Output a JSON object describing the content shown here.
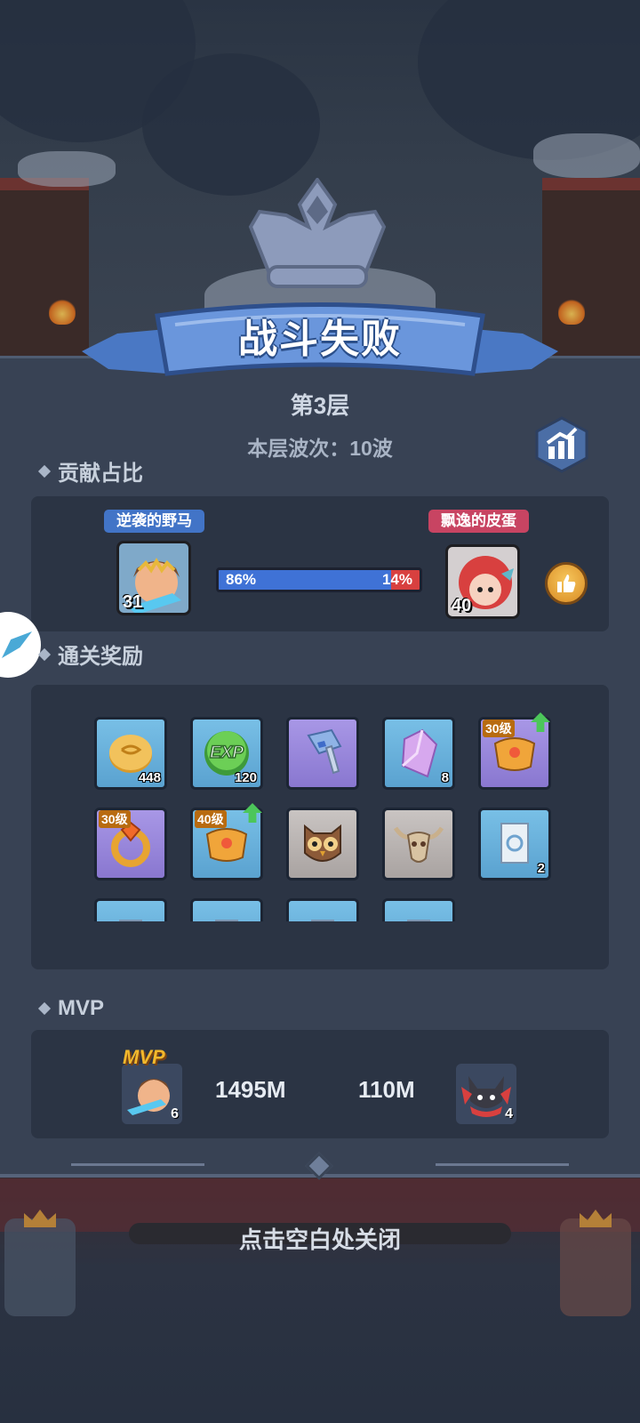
{
  "result": {
    "title": "战斗失败",
    "floor": "第3层",
    "wave_label": "本层波次：10波"
  },
  "contribution": {
    "section_title": "贡献占比",
    "left_player": {
      "name": "逆袭的野马",
      "level": "31",
      "percent_label": "86%"
    },
    "right_player": {
      "name": "飘逸的皮蛋",
      "level": "40",
      "percent_label": "14%"
    },
    "left_share": 0.86,
    "colors": {
      "left": "#3f72d6",
      "right": "#d8403f"
    }
  },
  "rewards": {
    "section_title": "通关奖励",
    "items": [
      {
        "icon": "gold-coin-icon",
        "count": "448",
        "frame": "blue"
      },
      {
        "icon": "exp-orb-icon",
        "count": "120",
        "frame": "blue"
      },
      {
        "icon": "hammer-icon",
        "count": "",
        "frame": "purple"
      },
      {
        "icon": "crystal-icon",
        "count": "8",
        "frame": "blue"
      },
      {
        "icon": "armor-icon",
        "level": "30级",
        "upgrade": true,
        "frame": "purple"
      },
      {
        "icon": "ring-icon",
        "level": "30级",
        "frame": "purple"
      },
      {
        "icon": "armor-icon",
        "level": "40级",
        "upgrade": true,
        "frame": "blue"
      },
      {
        "icon": "owl-mask-icon",
        "count": "",
        "frame": "gray"
      },
      {
        "icon": "bull-skull-icon",
        "count": "",
        "frame": "gray"
      },
      {
        "icon": "scroll-icon",
        "count": "2",
        "frame": "blue"
      }
    ]
  },
  "mvp": {
    "section_title": "MVP",
    "badge": "MVP",
    "left": {
      "count": "6",
      "damage": "1495M"
    },
    "right": {
      "count": "4",
      "damage": "110M"
    }
  },
  "close_hint": "点击空白处关闭"
}
